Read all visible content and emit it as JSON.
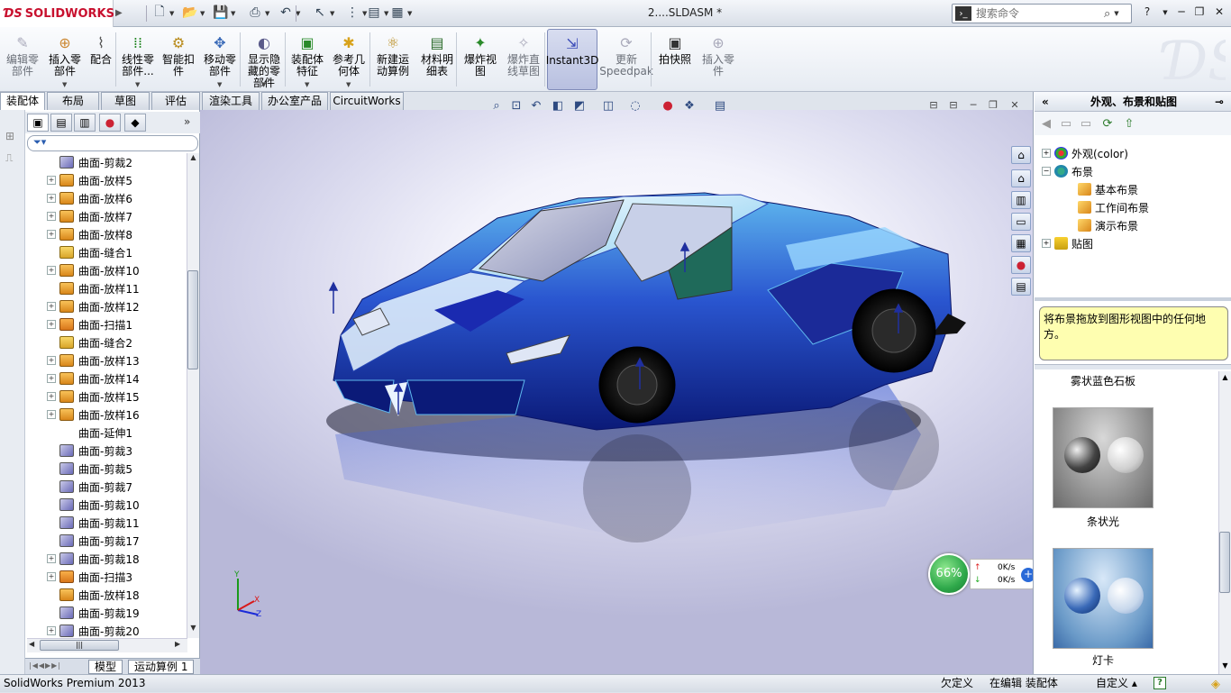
{
  "app": {
    "logo_text": "SOLIDWORKS",
    "doc_title": "2....SLDASM *"
  },
  "command_search": {
    "placeholder": "搜索命令"
  },
  "quick_access": {
    "icons": [
      "new-document-icon",
      "open-folder-icon",
      "save-icon",
      "print-icon",
      "undo-icon",
      "select-arrow-icon",
      "traffic-light-icon",
      "file-properties-icon",
      "options-icon"
    ]
  },
  "ribbon": {
    "items": [
      {
        "label": "编辑零\n部件",
        "icon": "edit-component-icon",
        "dim": true
      },
      {
        "label": "插入零\n部件",
        "icon": "insert-component-icon",
        "dim": false
      },
      {
        "label": "配合",
        "icon": "mate-icon",
        "dim": false
      },
      {
        "label": "线性零\n部件...",
        "icon": "linear-pattern-icon",
        "dim": false
      },
      {
        "label": "智能扣\n件",
        "icon": "smart-fastener-icon",
        "dim": false
      },
      {
        "label": "移动零\n部件",
        "icon": "move-component-icon",
        "dim": false
      },
      {
        "label": "显示隐\n藏的零\n部件",
        "icon": "show-hidden-icon",
        "dim": false
      },
      {
        "label": "装配体\n特征",
        "icon": "assembly-feature-icon",
        "dim": false
      },
      {
        "label": "参考几\n何体",
        "icon": "reference-geometry-icon",
        "dim": false
      },
      {
        "label": "新建运\n动算例",
        "icon": "new-motion-study-icon",
        "dim": false
      },
      {
        "label": "材料明\n细表",
        "icon": "bom-icon",
        "dim": false
      },
      {
        "label": "爆炸视\n图",
        "icon": "exploded-view-icon",
        "dim": false
      },
      {
        "label": "爆炸直\n线草图",
        "icon": "explode-line-sketch-icon",
        "dim": true
      },
      {
        "label": "Instant3D",
        "icon": "instant3d-icon",
        "dim": false
      },
      {
        "label": "更新\nSpeedpak",
        "icon": "update-speedpak-icon",
        "dim": true
      },
      {
        "label": "拍快照",
        "icon": "snapshot-icon",
        "dim": false
      },
      {
        "label": "插入零\n件",
        "icon": "insert-part-icon",
        "dim": true
      }
    ]
  },
  "tabs": [
    "装配体",
    "布局",
    "草图",
    "评估",
    "渲染工具",
    "办公室产品",
    "CircuitWorks"
  ],
  "feature_tree": {
    "items": [
      {
        "label": "曲面-剪裁2",
        "type": "trim",
        "expandable": false
      },
      {
        "label": "曲面-放样5",
        "type": "loft",
        "expandable": true
      },
      {
        "label": "曲面-放样6",
        "type": "loft",
        "expandable": true
      },
      {
        "label": "曲面-放样7",
        "type": "loft",
        "expandable": true
      },
      {
        "label": "曲面-放样8",
        "type": "loft",
        "expandable": true
      },
      {
        "label": "曲面-缝合1",
        "type": "knit",
        "expandable": false
      },
      {
        "label": "曲面-放样10",
        "type": "loft",
        "expandable": true
      },
      {
        "label": "曲面-放样11",
        "type": "loft",
        "expandable": false
      },
      {
        "label": "曲面-放样12",
        "type": "loft",
        "expandable": true
      },
      {
        "label": "曲面-扫描1",
        "type": "sweep",
        "expandable": true
      },
      {
        "label": "曲面-缝合2",
        "type": "knit",
        "expandable": false
      },
      {
        "label": "曲面-放样13",
        "type": "loft",
        "expandable": true
      },
      {
        "label": "曲面-放样14",
        "type": "loft",
        "expandable": true
      },
      {
        "label": "曲面-放样15",
        "type": "loft",
        "expandable": true
      },
      {
        "label": "曲面-放样16",
        "type": "loft",
        "expandable": true
      },
      {
        "label": "曲面-延伸1",
        "type": "extend",
        "expandable": false
      },
      {
        "label": "曲面-剪裁3",
        "type": "trim",
        "expandable": false
      },
      {
        "label": "曲面-剪裁5",
        "type": "trim",
        "expandable": false
      },
      {
        "label": "曲面-剪裁7",
        "type": "trim",
        "expandable": false
      },
      {
        "label": "曲面-剪裁10",
        "type": "trim",
        "expandable": false
      },
      {
        "label": "曲面-剪裁11",
        "type": "trim",
        "expandable": false
      },
      {
        "label": "曲面-剪裁17",
        "type": "trim",
        "expandable": false
      },
      {
        "label": "曲面-剪裁18",
        "type": "trim",
        "expandable": true
      },
      {
        "label": "曲面-扫描3",
        "type": "sweep",
        "expandable": true
      },
      {
        "label": "曲面-放样18",
        "type": "loft",
        "expandable": false
      },
      {
        "label": "曲面-剪裁19",
        "type": "trim",
        "expandable": false
      },
      {
        "label": "曲面-剪裁20",
        "type": "trim",
        "expandable": true
      }
    ]
  },
  "bottom_tabs": [
    "模型",
    "运动算例 1"
  ],
  "right_panel": {
    "title": "外观、布景和贴图",
    "tree": [
      {
        "label": "外观(color)",
        "indent": 0,
        "expandable": true,
        "expand_glyph": "+"
      },
      {
        "label": "布景",
        "indent": 0,
        "expandable": true,
        "expand_glyph": "−"
      },
      {
        "label": "基本布景",
        "indent": 1,
        "expandable": false
      },
      {
        "label": "工作间布景",
        "indent": 1,
        "expandable": false
      },
      {
        "label": "演示布景",
        "indent": 1,
        "expandable": false
      },
      {
        "label": "贴图",
        "indent": 0,
        "expandable": true,
        "expand_glyph": "+"
      }
    ],
    "hint": "将布景拖放到图形视图中的任何地方。",
    "gallery": [
      {
        "label": "雾状蓝色石板"
      },
      {
        "label": "条状光"
      },
      {
        "label": "灯卡"
      }
    ]
  },
  "speed_widget": {
    "percent": "66%",
    "up": "0K/s",
    "down": "0K/s"
  },
  "status": {
    "app_name": "SolidWorks Premium 2013",
    "definition": "欠定义",
    "editing": "在编辑 装配体",
    "custom": "自定义"
  },
  "colors": {
    "accent": "#1f3fbf",
    "car_body": "#1a2fa8",
    "car_highlight": "#4fb6e8",
    "hint_bg": "#fefeb0"
  }
}
